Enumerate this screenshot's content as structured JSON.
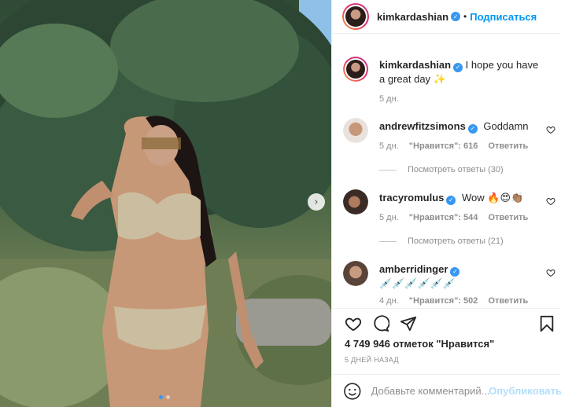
{
  "post": {
    "author": "kimkardashian",
    "follow_label": "Подписаться",
    "separator": "•",
    "caption": {
      "username": "kimkardashian",
      "text": "I hope you have a great day",
      "emoji": "✨",
      "time": "5 дн."
    },
    "carousel": {
      "total": 2,
      "active": 1
    },
    "next_arrow": "›",
    "likes": "4 749 946 отметок \"Нравится\"",
    "posted": "5 ДНЕЙ НАЗАД",
    "add_comment_placeholder": "Добавьте комментарий...",
    "publish_label": "Опубликовать"
  },
  "comments": [
    {
      "username": "andrewfitzsimons",
      "verified": true,
      "text": "Goddamn",
      "time": "5 дн.",
      "likes": "\"Нравится\": 616",
      "reply_label": "Ответить",
      "view_replies": "Посмотреть ответы (30)"
    },
    {
      "username": "tracyromulus",
      "verified": true,
      "text": "Wow 🔥😍👏🏽",
      "time": "5 дн.",
      "likes": "\"Нравится\": 544",
      "reply_label": "Ответить",
      "view_replies": "Посмотреть ответы (21)"
    },
    {
      "username": "amberridinger",
      "verified": true,
      "text": "💉💉💉💉💉💉",
      "time": "4 дн.",
      "likes": "\"Нравится\": 502",
      "reply_label": "Ответить"
    }
  ],
  "icons": {
    "like": "heart-icon",
    "comment": "comment-bubble-icon",
    "share": "paper-plane-icon",
    "save": "bookmark-icon",
    "emoji": "smiley-icon",
    "verified": "verified-badge-icon"
  },
  "colors": {
    "accent": "#0095f6",
    "verified": "#3897f0",
    "muted": "#8e8e8e",
    "publish_disabled": "#b2dffc"
  }
}
